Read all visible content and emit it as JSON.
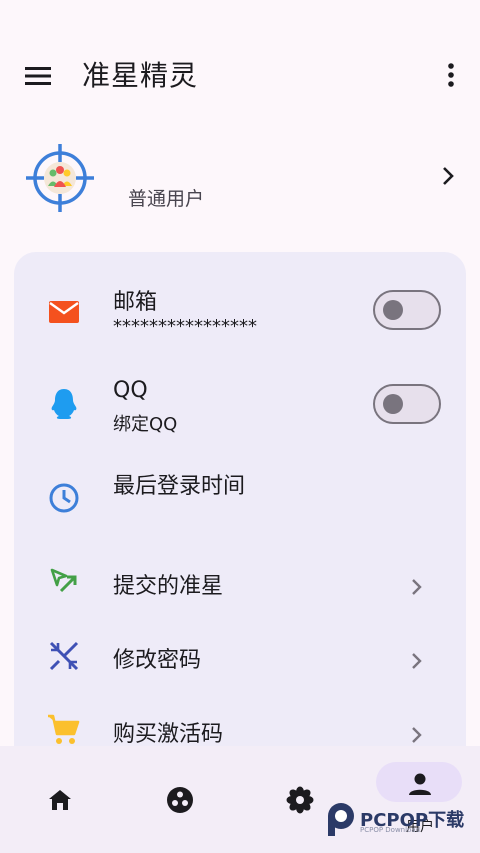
{
  "app": {
    "title": "准星精灵"
  },
  "profile": {
    "user_type": "普通用户"
  },
  "settings": {
    "email": {
      "label": "邮箱",
      "value": "****************",
      "toggle_on": false
    },
    "qq": {
      "label": "QQ",
      "value": "绑定QQ",
      "toggle_on": false
    },
    "last_login": {
      "label": "最后登录时间"
    },
    "submitted_crosshairs": {
      "label": "提交的准星"
    },
    "change_password": {
      "label": "修改密码"
    },
    "buy_code": {
      "label": "购买激活码"
    }
  },
  "nav": {
    "items": [
      {
        "icon": "home-icon"
      },
      {
        "icon": "community-icon"
      },
      {
        "icon": "flower-icon"
      },
      {
        "icon": "person-icon",
        "label": "用户",
        "active": true
      }
    ]
  },
  "watermark": {
    "text": "PCPOP下载"
  },
  "colors": {
    "background": "#fdf7fb",
    "card": "#eeebf8",
    "email_icon": "#f4511e",
    "qq_icon": "#1e9cf0",
    "clock_icon": "#3d7fd9",
    "submit_icon": "#43a047",
    "password_icon": "#3f51b5",
    "cart_icon": "#fbc02d",
    "nav_active": "#e8def8"
  }
}
